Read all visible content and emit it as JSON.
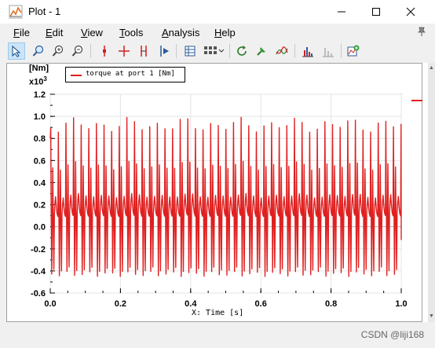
{
  "window": {
    "title": "Plot - 1",
    "minimize_icon": "minimize-icon",
    "maximize_icon": "maximize-icon",
    "close_icon": "close-icon"
  },
  "menu": [
    {
      "label": "File",
      "accel": "F"
    },
    {
      "label": "Edit",
      "accel": "E"
    },
    {
      "label": "View",
      "accel": "V"
    },
    {
      "label": "Tools",
      "accel": "T"
    },
    {
      "label": "Analysis",
      "accel": "A"
    },
    {
      "label": "Help",
      "accel": "H"
    }
  ],
  "toolbar": {
    "icons": [
      "select-arrow-icon",
      "zoom-region-icon",
      "zoom-in-icon",
      "zoom-out-icon",
      "cursor-single-icon",
      "cursor-cross-icon",
      "cursor-double-icon",
      "cursor-step-icon",
      "table-icon",
      "grid-layout-icon",
      "refresh-icon",
      "pin-curve-icon",
      "curves-icon",
      "histogram-icon",
      "fft-icon",
      "add-plot-icon"
    ]
  },
  "colors": {
    "accent": "#e02020",
    "toolbar_active": "#cce4f7"
  },
  "chart_data": {
    "type": "line",
    "title": "",
    "ylabel_unit": "[Nm]",
    "y_multiplier": "x10",
    "y_multiplier_exp": "3",
    "xlabel": "X: Time [s]",
    "xlim": [
      0.0,
      1.0
    ],
    "ylim": [
      -0.6,
      1.2
    ],
    "x_ticks": [
      "0.0",
      "0.2",
      "0.4",
      "0.6",
      "0.8",
      "1.0"
    ],
    "y_ticks": [
      "1.2",
      "1.0",
      "0.8",
      "0.6",
      "0.4",
      "0.2",
      "0.0",
      "-0.2",
      "-0.4",
      "-0.6"
    ],
    "grid": true,
    "legend": "top-left",
    "series": [
      {
        "name": "torque at port 1 [Nm]",
        "color": "#e02020",
        "period": 0.0217,
        "peak_max": 0.92,
        "peak_min": -0.45,
        "start_value": 0.8,
        "end_value": -0.12
      }
    ]
  },
  "watermark": "CSDN @liji168"
}
